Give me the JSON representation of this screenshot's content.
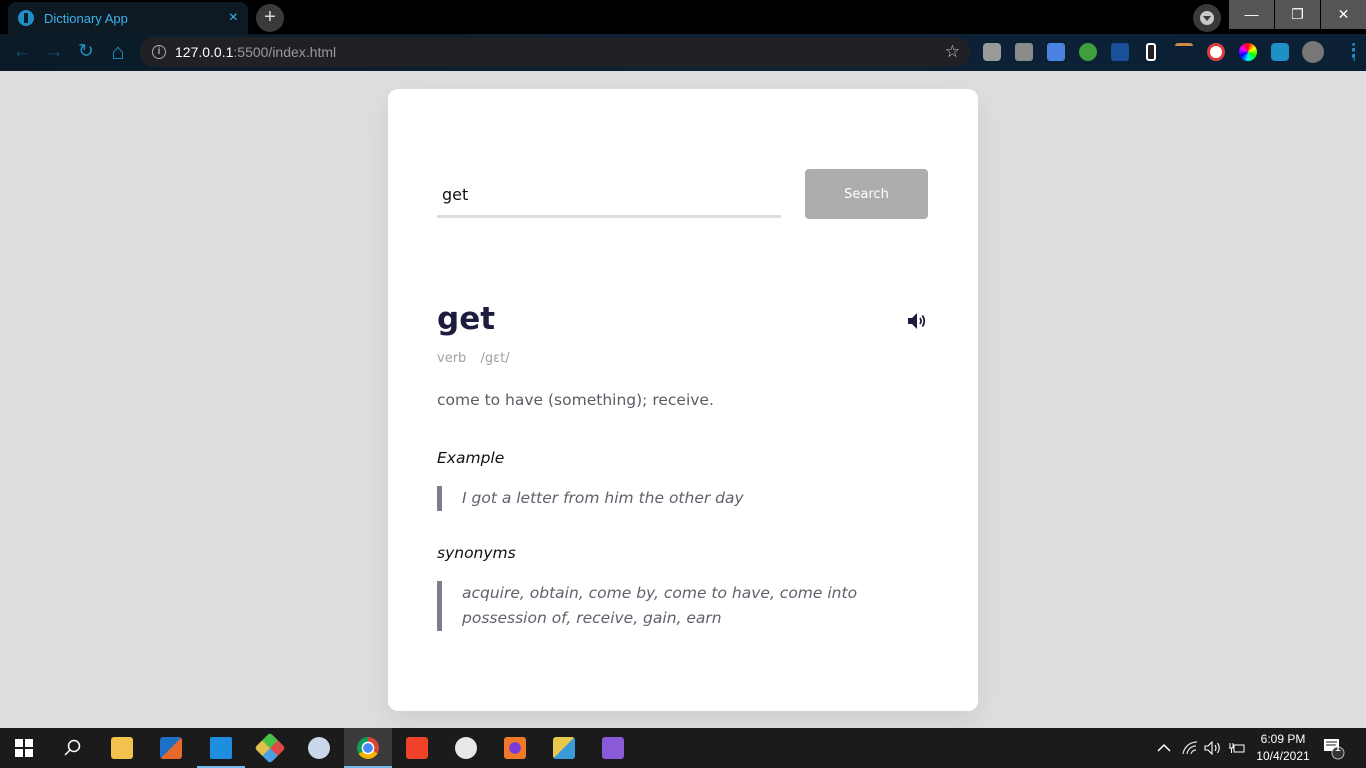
{
  "browser": {
    "tab_title": "Dictionary App",
    "tab_close_icon": "×",
    "new_tab_icon": "+",
    "url_host": "127.0.0.1",
    "url_rest": ":5500/index.html",
    "star_icon": "☆",
    "window_controls": {
      "minimize": "—",
      "restore": "❐",
      "close": "✕"
    },
    "nav": {
      "back": "←",
      "forward": "→",
      "reload": "↻",
      "home": "⌂"
    },
    "extensions": [
      "camera-icon",
      "screenshot-icon",
      "google-translate-icon",
      "grid-icon",
      "j-icon",
      "phone-frame-icon",
      "ruler-icon",
      "color-picker-icon",
      "color-wheel-icon",
      "puzzle-icon",
      "profile-avatar",
      "menu-icon"
    ]
  },
  "app": {
    "search": {
      "value": "get",
      "placeholder": "",
      "button_label": "Search"
    },
    "result": {
      "word": "get",
      "part_of_speech": "verb",
      "phonetic": "/gɛt/",
      "definition": "come to have (something); receive.",
      "example_label": "Example",
      "example": "I got a letter from him the other day",
      "synonyms_label": "synonyms",
      "synonyms": "acquire, obtain, come by, come to have, come into possession of, receive, gain, earn"
    },
    "colors": {
      "word": "#1d1b3e",
      "button": "#adadad",
      "quote_border": "#807e8c",
      "background": "#dedede"
    }
  },
  "taskbar": {
    "apps": [
      "windows-start",
      "search",
      "file-explorer",
      "outlook-visio",
      "vscode",
      "git-kraken",
      "paint",
      "chrome",
      "xampp",
      "emoji-app",
      "firefox",
      "db-tool",
      "visual-studio"
    ],
    "time": "6:09 PM",
    "date": "10/4/2021",
    "notification_count": "1"
  }
}
